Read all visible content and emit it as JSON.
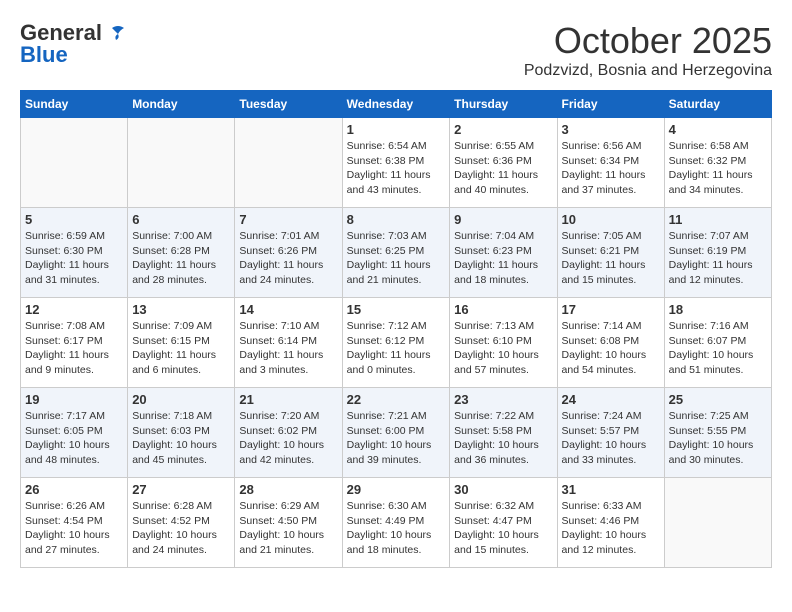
{
  "header": {
    "logo_line1": "General",
    "logo_line2": "Blue",
    "month": "October 2025",
    "location": "Podzvizd, Bosnia and Herzegovina"
  },
  "weekdays": [
    "Sunday",
    "Monday",
    "Tuesday",
    "Wednesday",
    "Thursday",
    "Friday",
    "Saturday"
  ],
  "weeks": [
    [
      {
        "day": "",
        "info": ""
      },
      {
        "day": "",
        "info": ""
      },
      {
        "day": "",
        "info": ""
      },
      {
        "day": "1",
        "info": "Sunrise: 6:54 AM\nSunset: 6:38 PM\nDaylight: 11 hours\nand 43 minutes."
      },
      {
        "day": "2",
        "info": "Sunrise: 6:55 AM\nSunset: 6:36 PM\nDaylight: 11 hours\nand 40 minutes."
      },
      {
        "day": "3",
        "info": "Sunrise: 6:56 AM\nSunset: 6:34 PM\nDaylight: 11 hours\nand 37 minutes."
      },
      {
        "day": "4",
        "info": "Sunrise: 6:58 AM\nSunset: 6:32 PM\nDaylight: 11 hours\nand 34 minutes."
      }
    ],
    [
      {
        "day": "5",
        "info": "Sunrise: 6:59 AM\nSunset: 6:30 PM\nDaylight: 11 hours\nand 31 minutes."
      },
      {
        "day": "6",
        "info": "Sunrise: 7:00 AM\nSunset: 6:28 PM\nDaylight: 11 hours\nand 28 minutes."
      },
      {
        "day": "7",
        "info": "Sunrise: 7:01 AM\nSunset: 6:26 PM\nDaylight: 11 hours\nand 24 minutes."
      },
      {
        "day": "8",
        "info": "Sunrise: 7:03 AM\nSunset: 6:25 PM\nDaylight: 11 hours\nand 21 minutes."
      },
      {
        "day": "9",
        "info": "Sunrise: 7:04 AM\nSunset: 6:23 PM\nDaylight: 11 hours\nand 18 minutes."
      },
      {
        "day": "10",
        "info": "Sunrise: 7:05 AM\nSunset: 6:21 PM\nDaylight: 11 hours\nand 15 minutes."
      },
      {
        "day": "11",
        "info": "Sunrise: 7:07 AM\nSunset: 6:19 PM\nDaylight: 11 hours\nand 12 minutes."
      }
    ],
    [
      {
        "day": "12",
        "info": "Sunrise: 7:08 AM\nSunset: 6:17 PM\nDaylight: 11 hours\nand 9 minutes."
      },
      {
        "day": "13",
        "info": "Sunrise: 7:09 AM\nSunset: 6:15 PM\nDaylight: 11 hours\nand 6 minutes."
      },
      {
        "day": "14",
        "info": "Sunrise: 7:10 AM\nSunset: 6:14 PM\nDaylight: 11 hours\nand 3 minutes."
      },
      {
        "day": "15",
        "info": "Sunrise: 7:12 AM\nSunset: 6:12 PM\nDaylight: 11 hours\nand 0 minutes."
      },
      {
        "day": "16",
        "info": "Sunrise: 7:13 AM\nSunset: 6:10 PM\nDaylight: 10 hours\nand 57 minutes."
      },
      {
        "day": "17",
        "info": "Sunrise: 7:14 AM\nSunset: 6:08 PM\nDaylight: 10 hours\nand 54 minutes."
      },
      {
        "day": "18",
        "info": "Sunrise: 7:16 AM\nSunset: 6:07 PM\nDaylight: 10 hours\nand 51 minutes."
      }
    ],
    [
      {
        "day": "19",
        "info": "Sunrise: 7:17 AM\nSunset: 6:05 PM\nDaylight: 10 hours\nand 48 minutes."
      },
      {
        "day": "20",
        "info": "Sunrise: 7:18 AM\nSunset: 6:03 PM\nDaylight: 10 hours\nand 45 minutes."
      },
      {
        "day": "21",
        "info": "Sunrise: 7:20 AM\nSunset: 6:02 PM\nDaylight: 10 hours\nand 42 minutes."
      },
      {
        "day": "22",
        "info": "Sunrise: 7:21 AM\nSunset: 6:00 PM\nDaylight: 10 hours\nand 39 minutes."
      },
      {
        "day": "23",
        "info": "Sunrise: 7:22 AM\nSunset: 5:58 PM\nDaylight: 10 hours\nand 36 minutes."
      },
      {
        "day": "24",
        "info": "Sunrise: 7:24 AM\nSunset: 5:57 PM\nDaylight: 10 hours\nand 33 minutes."
      },
      {
        "day": "25",
        "info": "Sunrise: 7:25 AM\nSunset: 5:55 PM\nDaylight: 10 hours\nand 30 minutes."
      }
    ],
    [
      {
        "day": "26",
        "info": "Sunrise: 6:26 AM\nSunset: 4:54 PM\nDaylight: 10 hours\nand 27 minutes."
      },
      {
        "day": "27",
        "info": "Sunrise: 6:28 AM\nSunset: 4:52 PM\nDaylight: 10 hours\nand 24 minutes."
      },
      {
        "day": "28",
        "info": "Sunrise: 6:29 AM\nSunset: 4:50 PM\nDaylight: 10 hours\nand 21 minutes."
      },
      {
        "day": "29",
        "info": "Sunrise: 6:30 AM\nSunset: 4:49 PM\nDaylight: 10 hours\nand 18 minutes."
      },
      {
        "day": "30",
        "info": "Sunrise: 6:32 AM\nSunset: 4:47 PM\nDaylight: 10 hours\nand 15 minutes."
      },
      {
        "day": "31",
        "info": "Sunrise: 6:33 AM\nSunset: 4:46 PM\nDaylight: 10 hours\nand 12 minutes."
      },
      {
        "day": "",
        "info": ""
      }
    ]
  ]
}
